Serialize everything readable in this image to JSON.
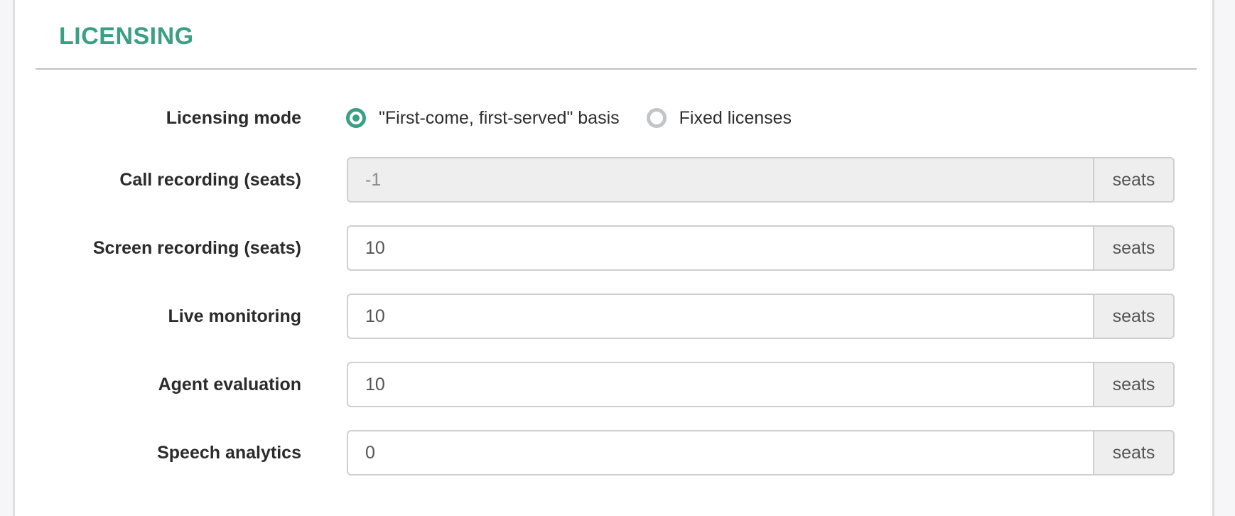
{
  "section": {
    "title": "LICENSING"
  },
  "licensing_mode": {
    "label": "Licensing mode",
    "options": [
      {
        "label": "\"First-come, first-served\" basis",
        "checked": true
      },
      {
        "label": "Fixed licenses",
        "checked": false
      }
    ]
  },
  "fields": [
    {
      "label": "Call recording (seats)",
      "value": "-1",
      "unit": "seats",
      "disabled": true
    },
    {
      "label": "Screen recording (seats)",
      "value": "10",
      "unit": "seats",
      "disabled": false
    },
    {
      "label": "Live monitoring",
      "value": "10",
      "unit": "seats",
      "disabled": false
    },
    {
      "label": "Agent evaluation",
      "value": "10",
      "unit": "seats",
      "disabled": false
    },
    {
      "label": "Speech analytics",
      "value": "0",
      "unit": "seats",
      "disabled": false
    }
  ],
  "colors": {
    "accent": "#3a9f84",
    "radio_unchecked": "#c2c5c8",
    "addon_bg": "#eeeeee",
    "disabled_bg": "#eeeeee"
  }
}
